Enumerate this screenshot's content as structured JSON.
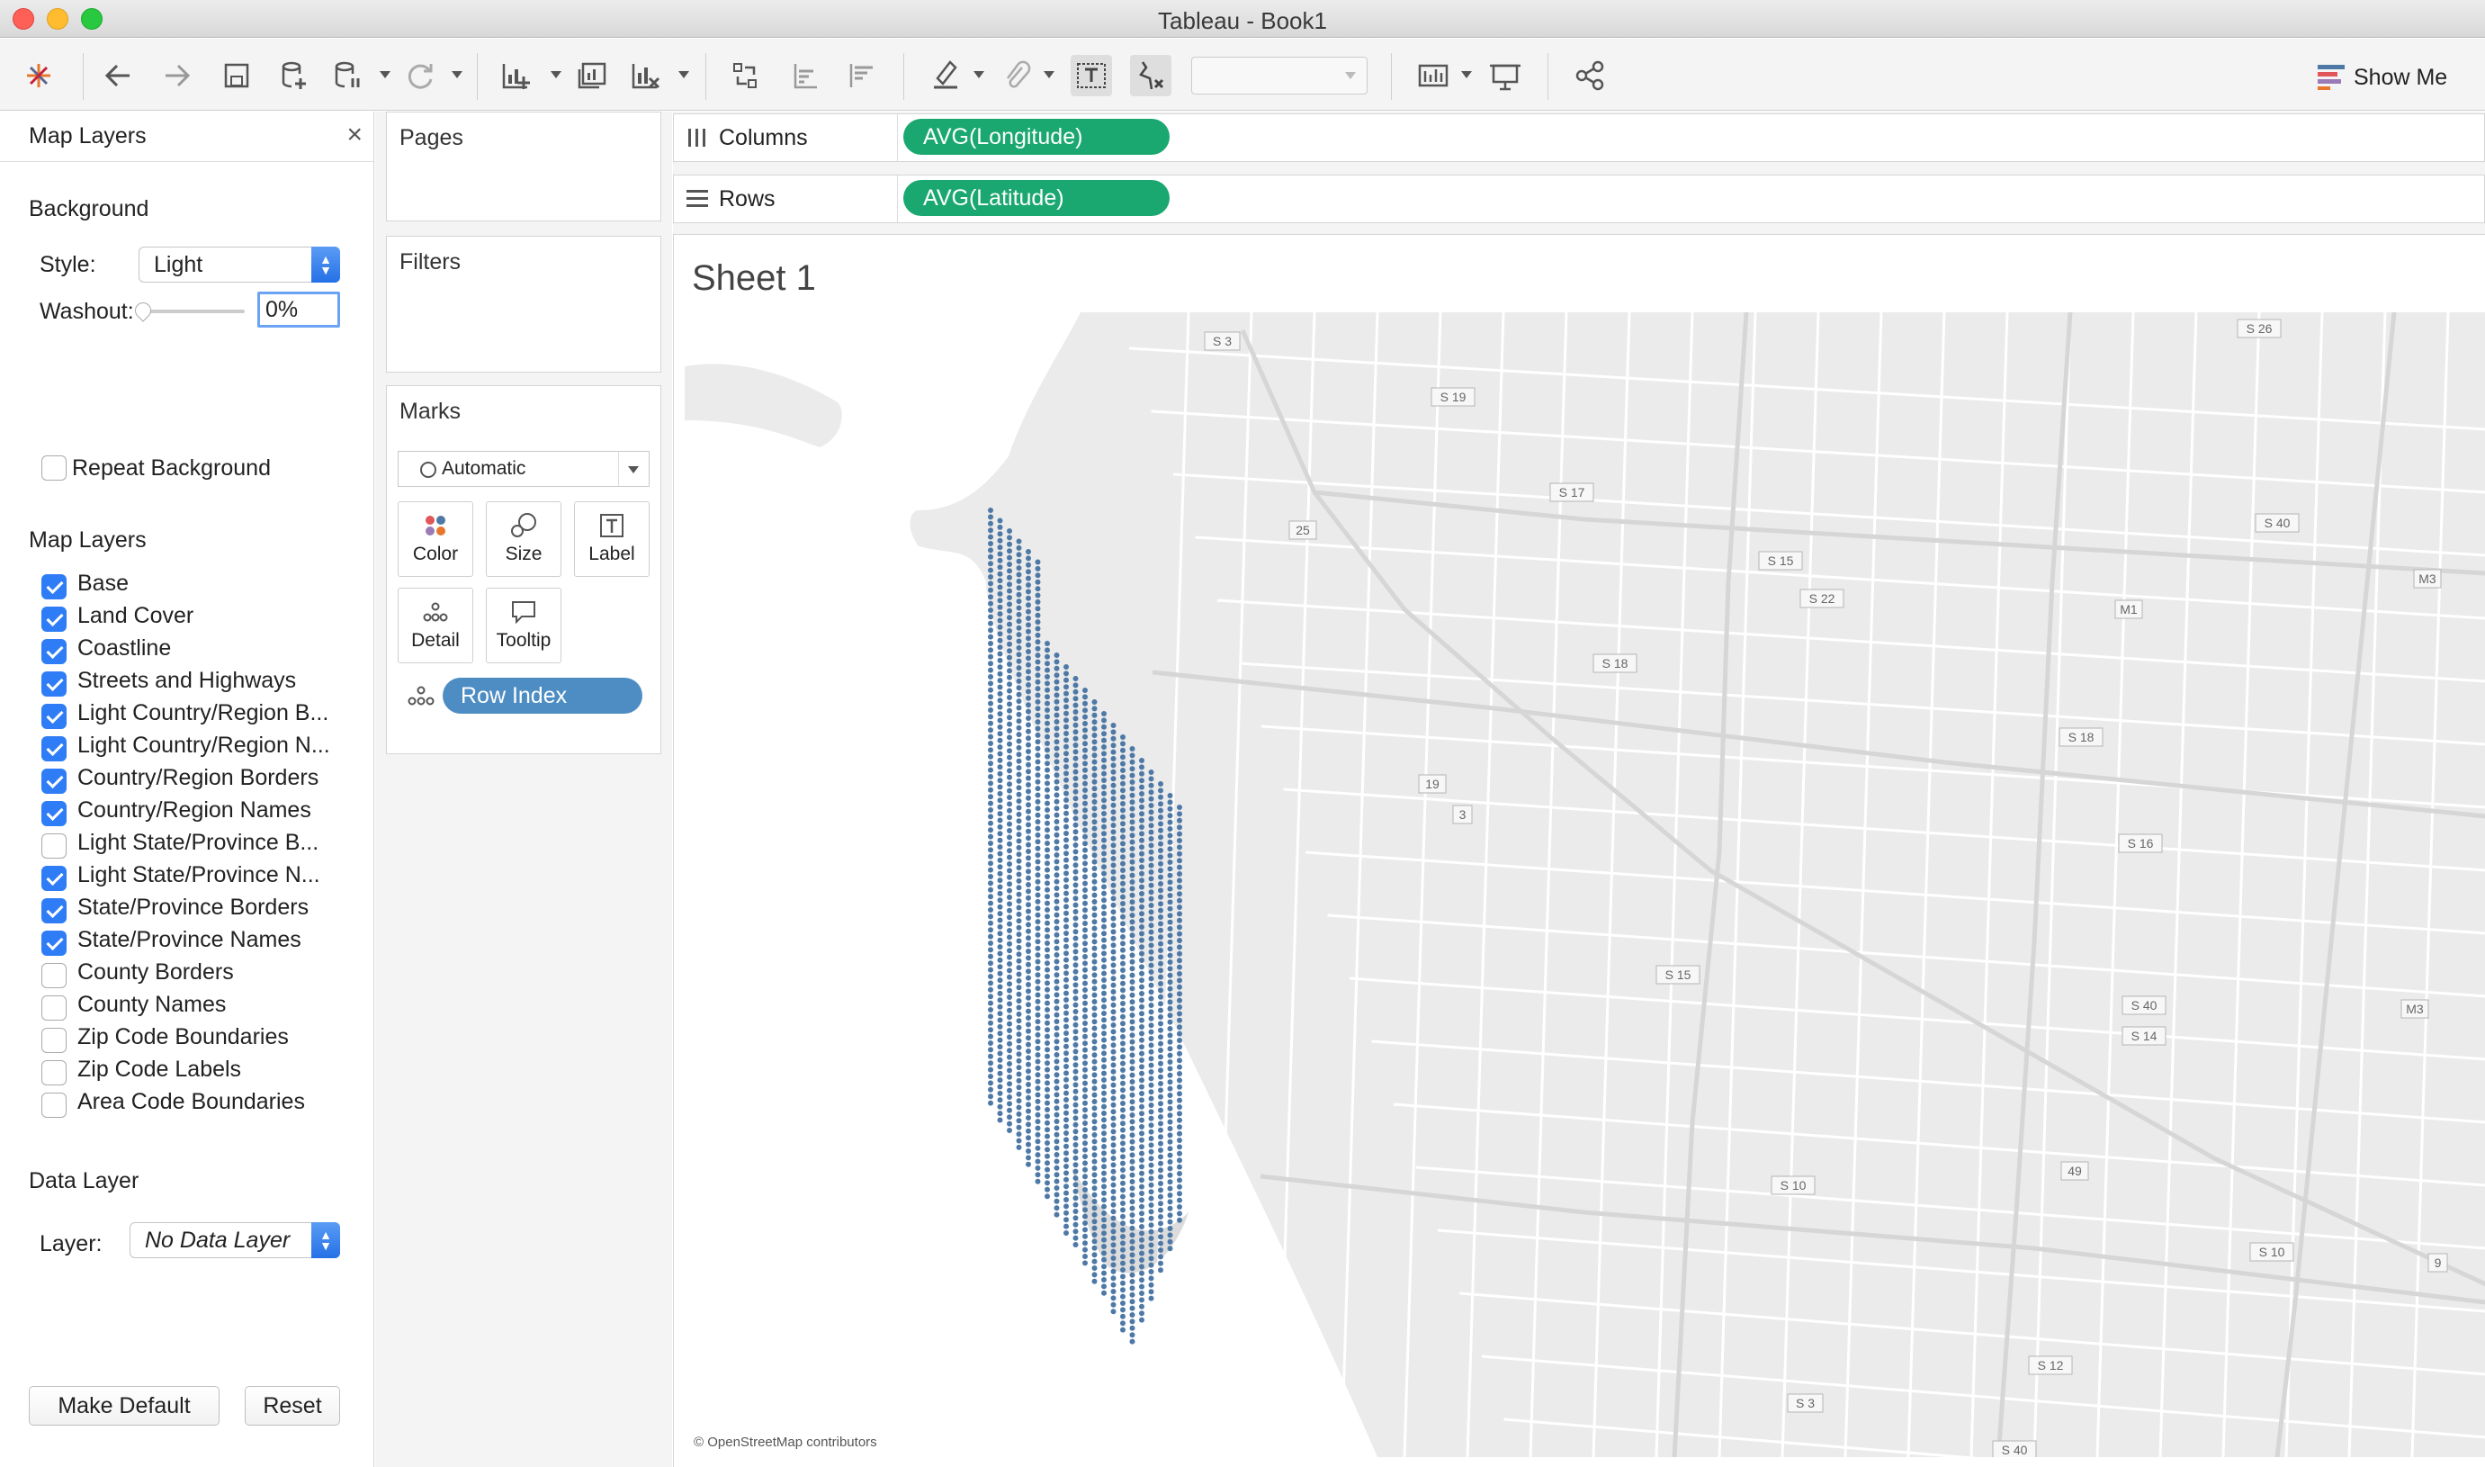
{
  "window": {
    "title": "Tableau - Book1"
  },
  "toolbar": {
    "show_me": "Show Me",
    "icons": [
      "tableau-logo-icon",
      "back-icon",
      "forward-icon",
      "save-icon",
      "new-data-source-icon",
      "pause-updates-icon",
      "refresh-icon",
      "new-worksheet-icon",
      "duplicate-sheet-icon",
      "clear-sheet-icon",
      "swap-rows-columns-icon",
      "sort-ascending-icon",
      "sort-descending-icon",
      "highlight-icon",
      "group-icon",
      "show-labels-icon",
      "fix-axes-icon",
      "fit-dropdown",
      "present-icon",
      "share-icon"
    ]
  },
  "map_layers_panel": {
    "title": "Map Layers",
    "background_heading": "Background",
    "style_label": "Style:",
    "style_value": "Light",
    "washout_label": "Washout:",
    "washout_value": "0%",
    "repeat_background_label": "Repeat Background",
    "repeat_background_checked": false,
    "layers_heading": "Map Layers",
    "layers": [
      {
        "label": "Base",
        "checked": true
      },
      {
        "label": "Land Cover",
        "checked": true
      },
      {
        "label": "Coastline",
        "checked": true
      },
      {
        "label": "Streets and Highways",
        "checked": true
      },
      {
        "label": "Light Country/Region B...",
        "checked": true
      },
      {
        "label": "Light Country/Region N...",
        "checked": true
      },
      {
        "label": "Country/Region Borders",
        "checked": true
      },
      {
        "label": "Country/Region Names",
        "checked": true
      },
      {
        "label": "Light State/Province B...",
        "checked": false
      },
      {
        "label": "Light State/Province N...",
        "checked": true
      },
      {
        "label": "State/Province Borders",
        "checked": true
      },
      {
        "label": "State/Province Names",
        "checked": true
      },
      {
        "label": "County Borders",
        "checked": false
      },
      {
        "label": "County Names",
        "checked": false
      },
      {
        "label": "Zip Code Boundaries",
        "checked": false
      },
      {
        "label": "Zip Code Labels",
        "checked": false
      },
      {
        "label": "Area Code Boundaries",
        "checked": false
      }
    ],
    "data_layer_heading": "Data Layer",
    "layer_label": "Layer:",
    "layer_value": "No Data Layer",
    "make_default": "Make Default",
    "reset": "Reset"
  },
  "pages": {
    "title": "Pages"
  },
  "filters": {
    "title": "Filters"
  },
  "marks": {
    "title": "Marks",
    "type": "Automatic",
    "buttons": {
      "color": "Color",
      "size": "Size",
      "label": "Label",
      "detail": "Detail",
      "tooltip": "Tooltip"
    },
    "field": "Row Index"
  },
  "columns": {
    "label": "Columns",
    "pill": "AVG(Longitude)"
  },
  "rows": {
    "label": "Rows",
    "pill": "AVG(Latitude)"
  },
  "sheet": {
    "title": "Sheet 1"
  },
  "map": {
    "attribution": "© OpenStreetMap contributors",
    "road_shields": [
      "S 3",
      "S 19",
      "S 26",
      "S 17",
      "S 40",
      "M3",
      "25",
      "S 15",
      "S 22",
      "M1",
      "S 18",
      "S 18",
      "19",
      "3",
      "S 16",
      "S 15",
      "S 40",
      "M3",
      "S 14",
      "S 10",
      "49",
      "S 10",
      "9",
      "S 12",
      "S 3",
      "S 40"
    ],
    "mark_color": "#4e79a7"
  },
  "colors": {
    "pill": "#1aa870",
    "checkbox": "#2f7df6",
    "marks": "#4e79a7"
  }
}
